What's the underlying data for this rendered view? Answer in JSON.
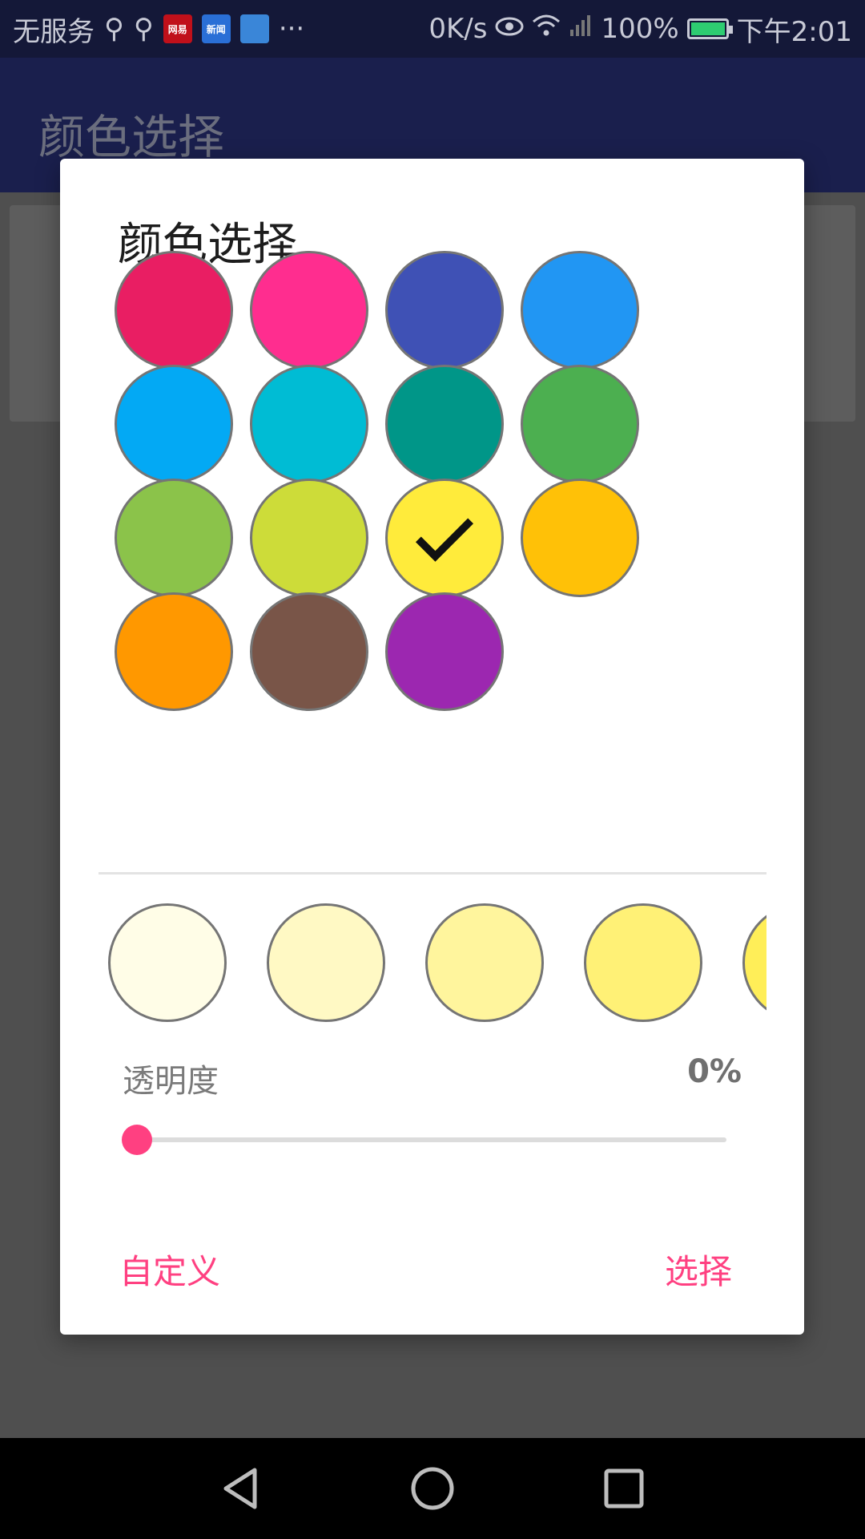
{
  "status_bar": {
    "carrier": "无服务",
    "app_icons": [
      {
        "label": "网易",
        "color": "#c0101a"
      },
      {
        "label": "新闻",
        "color": "#2a6fd6"
      },
      {
        "label": "",
        "color": "#3a86d8"
      }
    ],
    "overflow": "···",
    "speed": "0K/s",
    "battery": "100%",
    "time": "下午2:01"
  },
  "toolbar": {
    "title": "颜色选择"
  },
  "dialog": {
    "title": "颜色选择",
    "palette": [
      {
        "name": "red",
        "color": "#E91E63"
      },
      {
        "name": "pink",
        "color": "#FF2D8F"
      },
      {
        "name": "indigo",
        "color": "#3F51B5"
      },
      {
        "name": "blue",
        "color": "#2196F3"
      },
      {
        "name": "light-blue",
        "color": "#03A9F4"
      },
      {
        "name": "cyan",
        "color": "#00BCD4"
      },
      {
        "name": "teal",
        "color": "#009688"
      },
      {
        "name": "green",
        "color": "#4CAF50"
      },
      {
        "name": "light-green",
        "color": "#8BC34A"
      },
      {
        "name": "lime",
        "color": "#CDDC39"
      },
      {
        "name": "yellow",
        "color": "#FFEB3B",
        "selected": true
      },
      {
        "name": "amber",
        "color": "#FFC107"
      },
      {
        "name": "orange",
        "color": "#FF9800"
      },
      {
        "name": "brown",
        "color": "#795548"
      },
      {
        "name": "purple",
        "color": "#9C27B0"
      }
    ],
    "shades": [
      "#FFFDE7",
      "#FFF9C4",
      "#FFF59D",
      "#FFF176",
      "#FFEE58"
    ],
    "alpha_label": "透明度",
    "alpha_value": "0%",
    "alpha_level": 0,
    "custom_button": "自定义",
    "select_button": "选择",
    "accent_color": "#FF4081"
  }
}
